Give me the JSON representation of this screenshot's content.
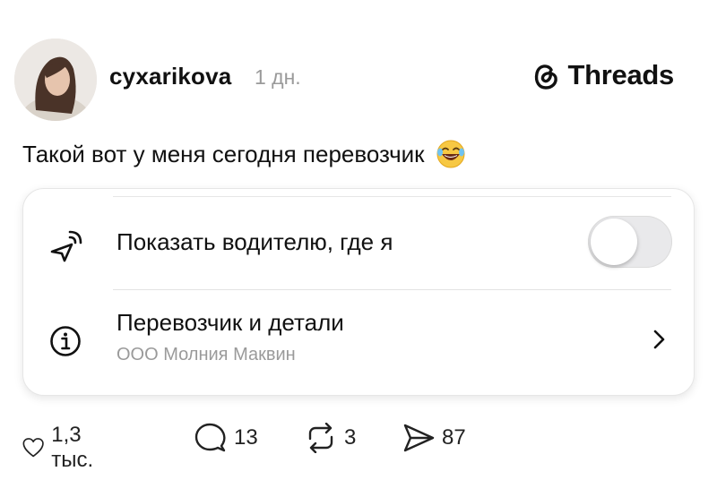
{
  "post": {
    "username": "cyxarikova",
    "time": "1 дн.",
    "brand": "Threads",
    "text": "Такой вот у меня сегодня перевозчик",
    "emoji": "😂"
  },
  "card": {
    "share_location_label": "Показать водителю, где я",
    "share_location_on": false,
    "carrier_label": "Перевозчик и детали",
    "carrier_name": "ООО Молния Маквин"
  },
  "actions": {
    "likes": "1,3 тыс.",
    "replies": "13",
    "reposts": "3",
    "shares": "87"
  },
  "icons": {
    "brand": "threads-logo-icon",
    "location": "location-share-icon",
    "info": "info-icon",
    "chevron": "chevron-right-icon",
    "like": "heart-icon",
    "reply": "comment-icon",
    "repost": "repost-icon",
    "share": "send-icon"
  }
}
